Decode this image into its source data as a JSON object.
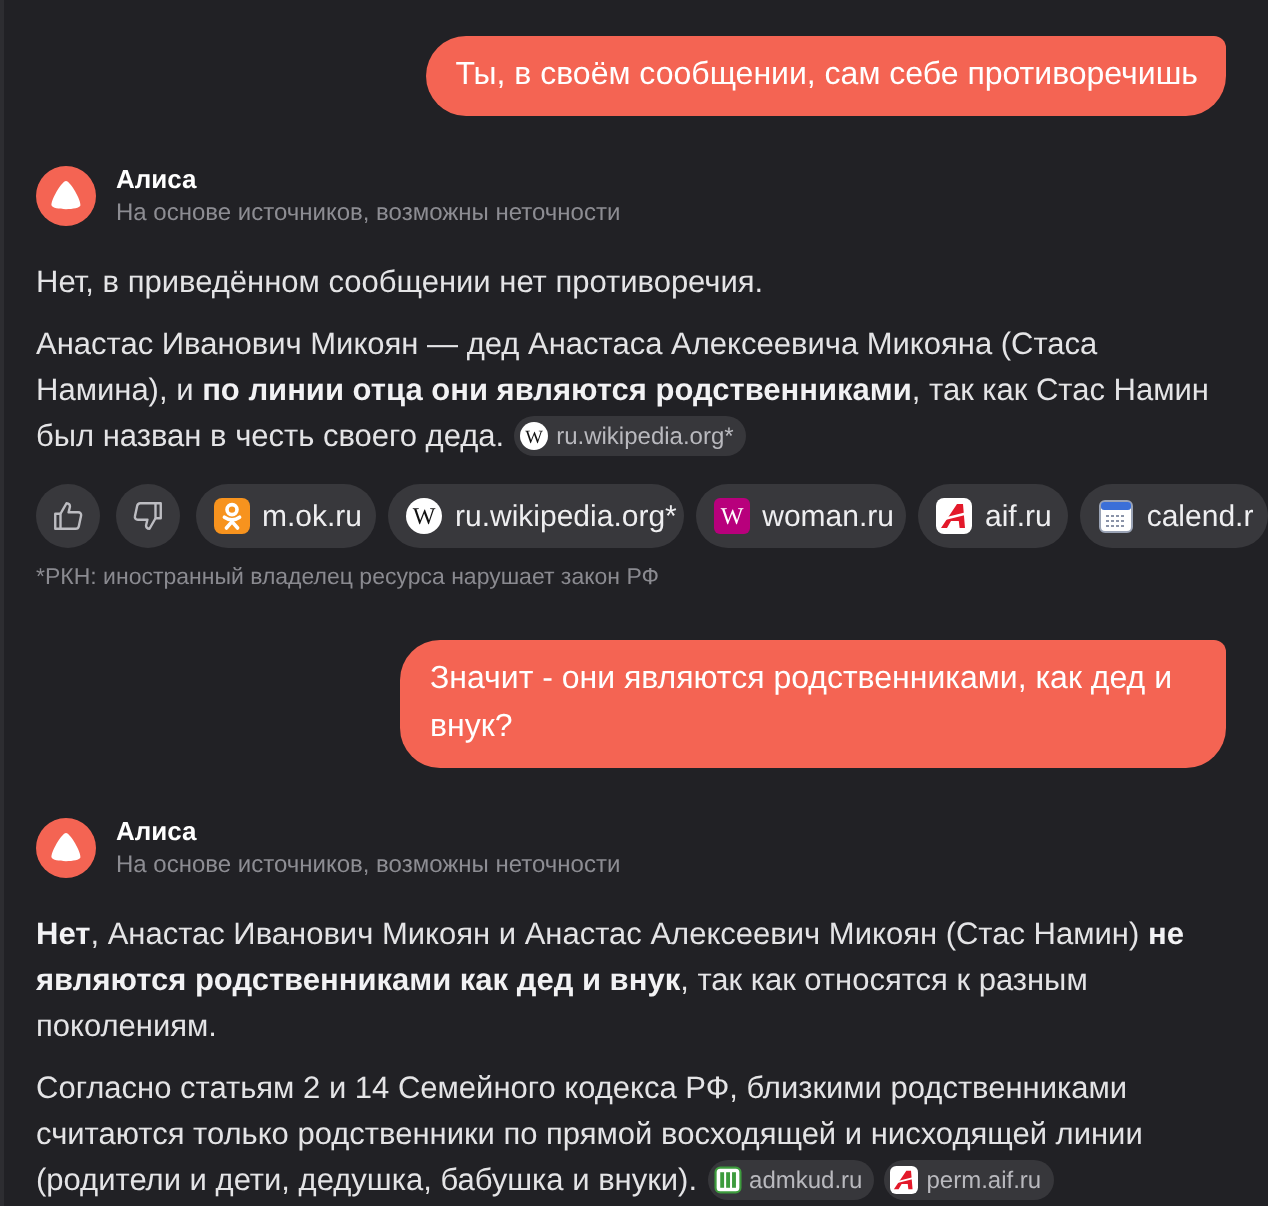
{
  "messages": [
    {
      "kind": "user",
      "text": "Ты, в своём сообщении, сам себе противоречишь"
    },
    {
      "kind": "assistant",
      "author": "Алиса",
      "subtitle": "На основе источников, возможны неточности",
      "paragraphs": [
        {
          "text": "Нет, в приведённом сообщении нет противоречия."
        },
        {
          "text": "Анастас Иванович Микоян — дед Анастаса Алексеевича Микояна (Стаса Намина), и **по линии отца они являются родственниками**, так как Стас Намин был назван в честь своего деда.",
          "sources": [
            {
              "kind": "wiki",
              "glyph": "W",
              "label": "ru.wikipedia.org*"
            }
          ]
        }
      ],
      "actions": [
        {
          "kind": "like"
        },
        {
          "kind": "dislike"
        }
      ],
      "source_chips": [
        {
          "kind": "ok",
          "label": "m.ok.ru"
        },
        {
          "kind": "wiki",
          "glyph": "W",
          "label": "ru.wikipedia.org*"
        },
        {
          "kind": "woman",
          "glyph": "W",
          "label": "woman.ru"
        },
        {
          "kind": "aif",
          "label": "aif.ru"
        },
        {
          "kind": "calendar",
          "label": "calend.r"
        }
      ],
      "footnote": "*РКН: иностранный владелец ресурса нарушает закон РФ"
    },
    {
      "kind": "user",
      "text": "Значит - они являются родственниками, как дед и внук?"
    },
    {
      "kind": "assistant",
      "author": "Алиса",
      "subtitle": "На основе источников, возможны неточности",
      "paragraphs": [
        {
          "text": "**Нет**, Анастас Иванович Микоян и Анастас Алексеевич Микоян (Стас Намин) **не являются родственниками как дед и внук**, так как относятся к разным поколениям."
        },
        {
          "text": "Согласно статьям 2 и 14 Семейного кодекса РФ, близкими родственниками считаются только родственники по прямой восходящей и нисходящей линии (родители и дети, дедушка, бабушка и внуки).",
          "sources": [
            {
              "kind": "admkud",
              "label": "admkud.ru"
            },
            {
              "kind": "aif",
              "label": "perm.aif.ru"
            }
          ]
        }
      ]
    }
  ]
}
